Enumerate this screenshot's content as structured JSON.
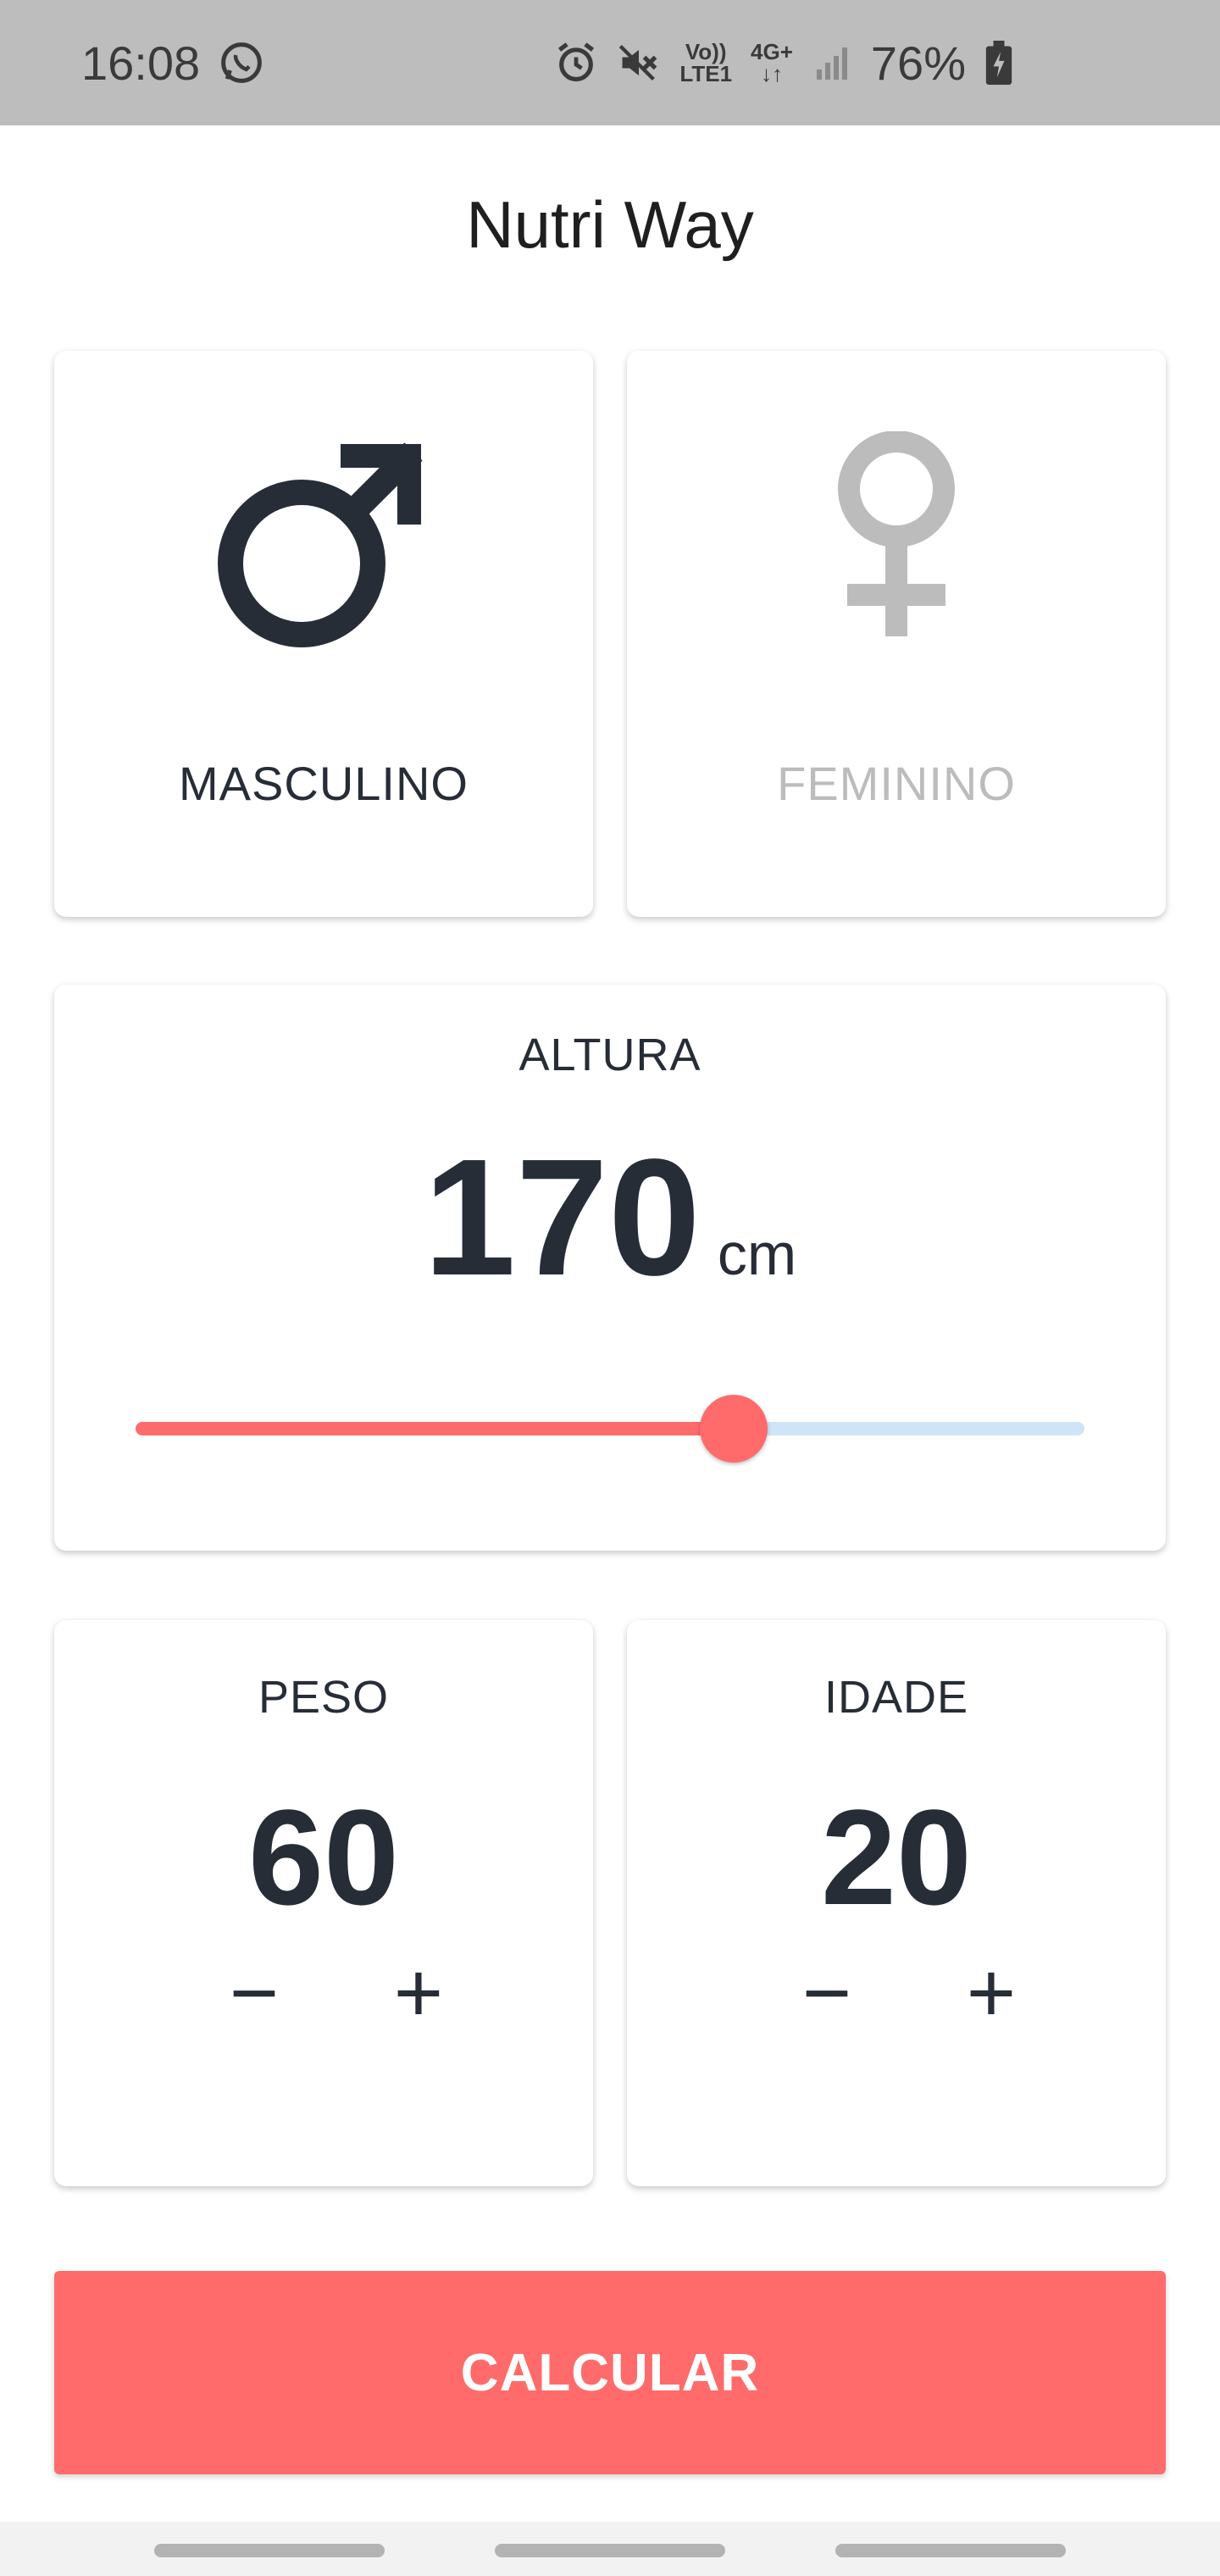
{
  "status_bar": {
    "time": "16:08",
    "network_top": "Vo))",
    "network_bottom": "LTE1",
    "data_type": "4G+",
    "battery": "76%",
    "icons": [
      "whatsapp-icon",
      "alarm-icon",
      "mute-icon",
      "signal-icon",
      "battery-charging-icon"
    ]
  },
  "app": {
    "title": "Nutri Way"
  },
  "gender": {
    "male_label": "MASCULINO",
    "female_label": "FEMININO",
    "selected": "male"
  },
  "height": {
    "label": "ALTURA",
    "value": "170",
    "unit": "cm",
    "slider_fraction": 0.63
  },
  "weight": {
    "label": "PESO",
    "value": "60",
    "minus": "−",
    "plus": "+"
  },
  "age": {
    "label": "IDADE",
    "value": "20",
    "minus": "−",
    "plus": "+"
  },
  "calculate_button": "CALCULAR",
  "colors": {
    "accent": "#ff6b6b",
    "slider_inactive": "#cfe4f7",
    "text_dark": "#272d36",
    "text_inactive": "#bcbcbc",
    "status_bar": "#bdbdbd"
  }
}
